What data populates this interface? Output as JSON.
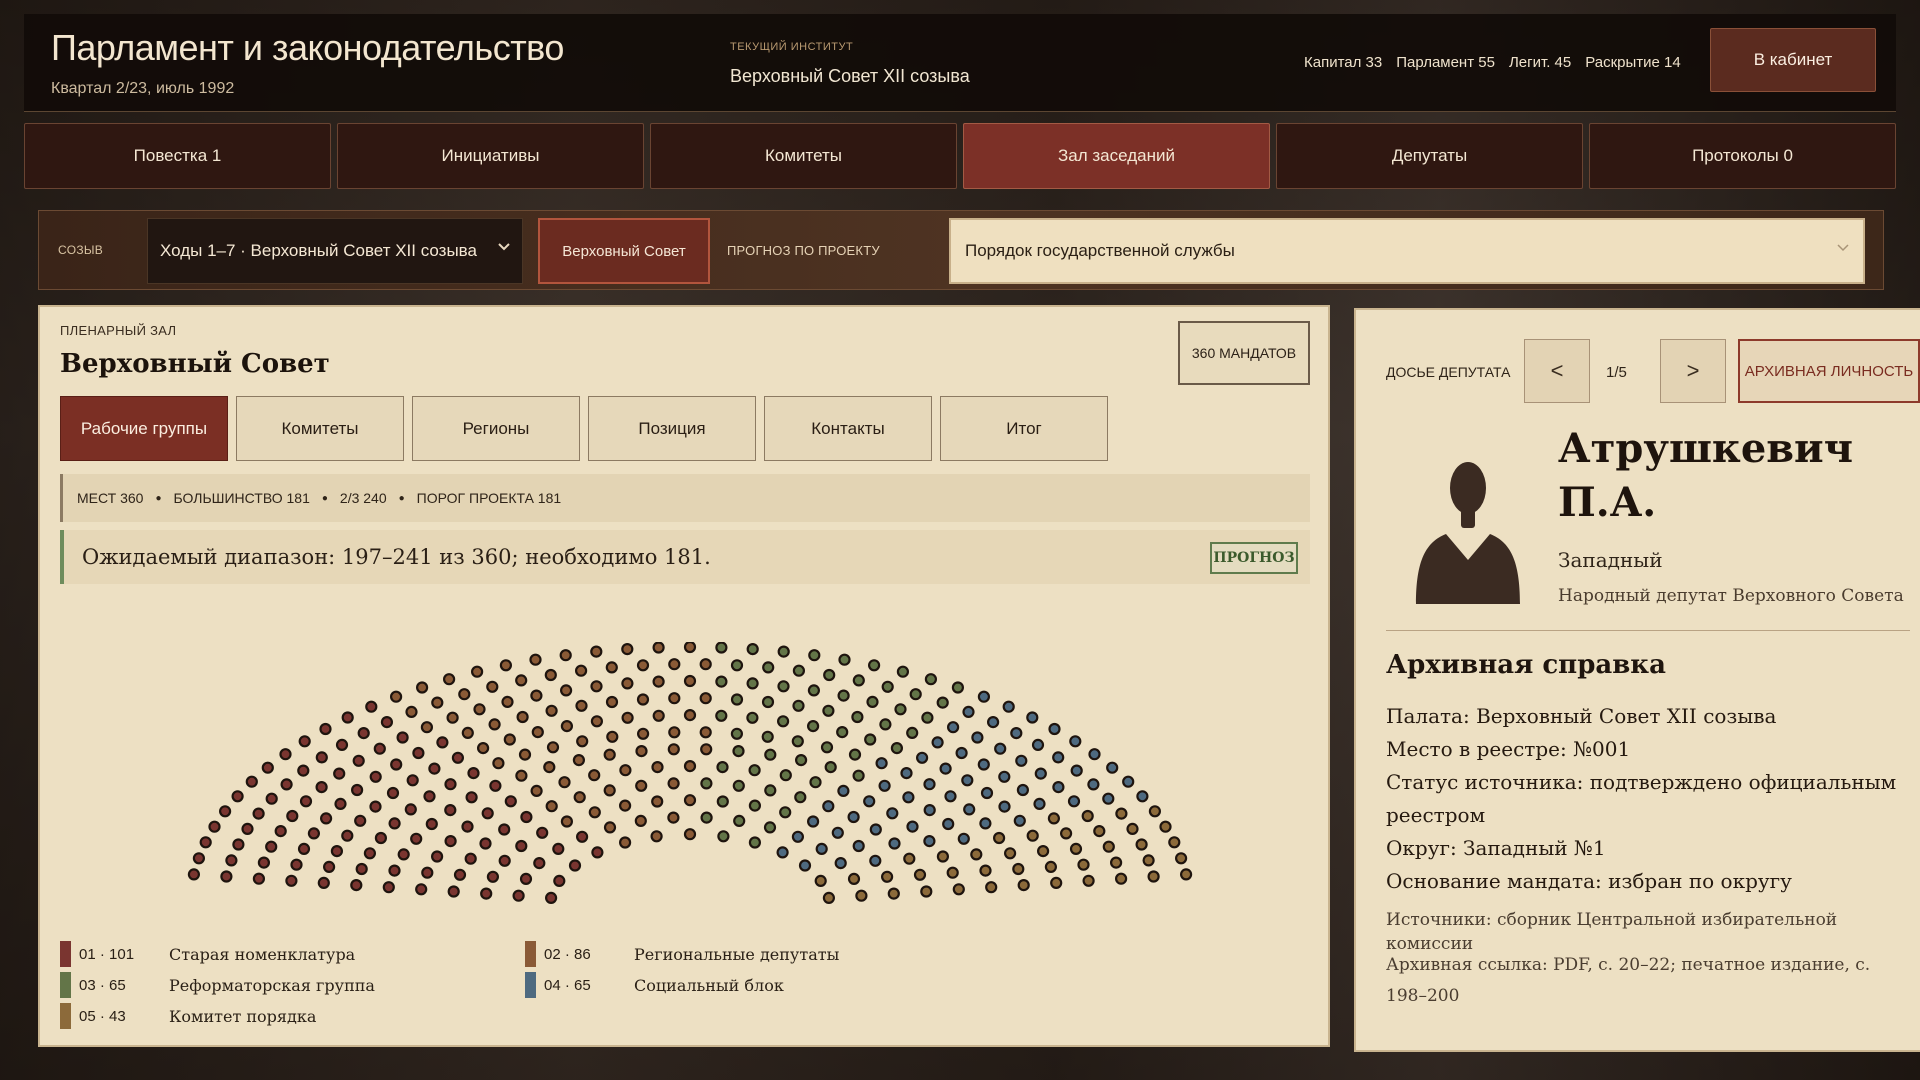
{
  "header": {
    "title": "Парламент и законодательство",
    "subtitle": "Квартал 2/23, июль 1992",
    "institute_label": "ТЕКУЩИЙ ИНСТИТУТ",
    "institute_value": "Верховный Совет XII созыва",
    "stats": [
      "Капитал 33",
      "Парламент 55",
      "Легит. 45",
      "Раскрытие 14"
    ],
    "cabinet_button": "В кабинет"
  },
  "tabs": [
    {
      "label": "Повестка  1",
      "active": false
    },
    {
      "label": "Инициативы",
      "active": false
    },
    {
      "label": "Комитеты",
      "active": false
    },
    {
      "label": "Зал заседаний",
      "active": true
    },
    {
      "label": "Депутаты",
      "active": false
    },
    {
      "label": "Протоколы  0",
      "active": false
    }
  ],
  "filters": {
    "convocation_label": "СОЗЫВ",
    "convocation_value": "Ходы 1–7 · Верховный Совет XII созыва",
    "chamber_button": "Верховный Совет",
    "forecast_label": "ПРОГНОЗ ПО ПРОЕКТУ",
    "project_value": "Порядок государственной службы"
  },
  "hall": {
    "label": "ПЛЕНАРНЫЙ ЗАЛ",
    "title": "Верховный Совет",
    "mandates_badge": "360 МАНДАТОВ",
    "subtabs": [
      {
        "label": "Рабочие группы",
        "active": true
      },
      {
        "label": "Комитеты",
        "active": false
      },
      {
        "label": "Регионы",
        "active": false
      },
      {
        "label": "Позиция",
        "active": false
      },
      {
        "label": "Контакты",
        "active": false
      },
      {
        "label": "Итог",
        "active": false
      }
    ],
    "info": [
      "МЕСТ 360",
      "БОЛЬШИНСТВО 181",
      "2/3 240",
      "ПОРОГ ПРОЕКТА 181"
    ],
    "forecast_text": "Ожидаемый диапазон: 197–241 из 360; необходимо 181.",
    "forecast_badge": "ПРОГНОЗ",
    "total_seats": 360,
    "groups": [
      {
        "code": "01 · 101",
        "name": "Старая номенклатура",
        "seats": 101,
        "color": "#7a3530"
      },
      {
        "code": "02 · 86",
        "name": "Региональные депутаты",
        "seats": 86,
        "color": "#8a5a36"
      },
      {
        "code": "03 · 65",
        "name": "Реформаторская группа",
        "seats": 65,
        "color": "#637548"
      },
      {
        "code": "04 · 65",
        "name": "Социальный блок",
        "seats": 65,
        "color": "#4e6a80"
      },
      {
        "code": "05 · 43",
        "name": "Комитет порядка",
        "seats": 43,
        "color": "#8c6a3a"
      }
    ]
  },
  "dossier": {
    "label": "ДОСЬЕ ДЕПУТАТА",
    "prev": "<",
    "next": ">",
    "pager": "1/5",
    "archive_button": "АРХИВНАЯ ЛИЧНОСТЬ",
    "name": "Атрушкевич П.А.",
    "region": "Западный",
    "role": "Народный депутат Верховного Совета",
    "ref_title": "Архивная справка",
    "ref_lines": [
      "Палата: Верховный Совет XII созыва",
      "Место в реестре: №001",
      "Статус источника: подтверждено официальным реестром",
      "Округ: Западный №1",
      "Основание мандата: избран по округу"
    ],
    "sources": "Источники: сборник Центральной избирательной комиссии",
    "archive_link": "Архивная ссылка: PDF, с. 20–22; печатное издание, с. 198–200"
  }
}
